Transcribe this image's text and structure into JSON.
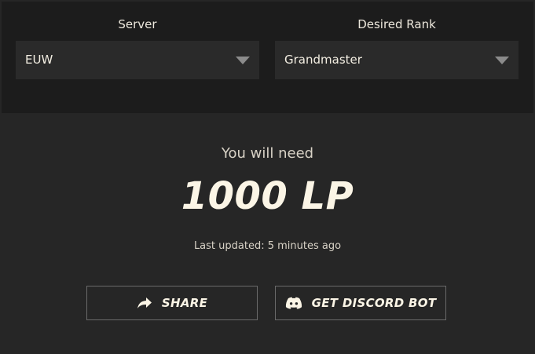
{
  "server": {
    "label": "Server",
    "selected": "EUW"
  },
  "desired_rank": {
    "label": "Desired Rank",
    "selected": "Grandmaster"
  },
  "result": {
    "intro": "You will need",
    "value": "1000 LP",
    "updated": "Last updated: 5 minutes ago"
  },
  "actions": {
    "share_label": "SHARE",
    "discord_label": "GET DISCORD BOT"
  },
  "icons": {
    "share": "share-arrow-icon",
    "discord": "discord-icon",
    "dropdown": "chevron-down-icon"
  },
  "colors": {
    "background": "#262626",
    "top_panel": "#1c1c1c",
    "select_bg": "#2a2a2a",
    "text_primary": "#fbf5e6",
    "text_secondary": "#d8d2c6",
    "button_border": "#6a6a6a"
  }
}
